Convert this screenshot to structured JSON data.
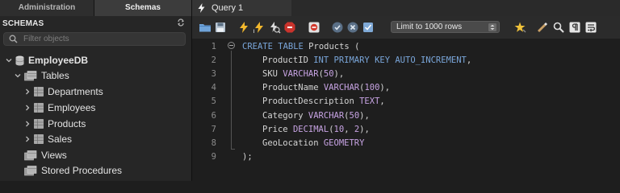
{
  "left_tabs": {
    "administration": "Administration",
    "schemas": "Schemas"
  },
  "schemas_panel": {
    "title": "SCHEMAS",
    "filter_placeholder": "Filter objects",
    "database": "EmployeeDB",
    "tables_folder": "Tables",
    "tables": [
      "Departments",
      "Employees",
      "Products",
      "Sales"
    ],
    "views_folder": "Views",
    "procedures_folder": "Stored Procedures"
  },
  "query_tab": {
    "label": "Query 1"
  },
  "toolbar": {
    "limit_label": "Limit to 1000 rows"
  },
  "editor": {
    "line_numbers": [
      "1",
      "2",
      "3",
      "4",
      "5",
      "6",
      "7",
      "8",
      "9"
    ],
    "lines": [
      [
        {
          "t": "CREATE TABLE",
          "c": "kw"
        },
        {
          "t": " Products (",
          "c": ""
        }
      ],
      [
        {
          "t": "ProductID ",
          "c": ""
        },
        {
          "t": "INT PRIMARY KEY AUTO_INCREMENT",
          "c": "kw"
        },
        {
          "t": ",",
          "c": ""
        }
      ],
      [
        {
          "t": "SKU ",
          "c": ""
        },
        {
          "t": "VARCHAR",
          "c": "ty"
        },
        {
          "t": "(",
          "c": ""
        },
        {
          "t": "50",
          "c": "nm"
        },
        {
          "t": "),",
          "c": ""
        }
      ],
      [
        {
          "t": "ProductName ",
          "c": ""
        },
        {
          "t": "VARCHAR",
          "c": "ty"
        },
        {
          "t": "(",
          "c": ""
        },
        {
          "t": "100",
          "c": "nm"
        },
        {
          "t": "),",
          "c": ""
        }
      ],
      [
        {
          "t": "ProductDescription ",
          "c": ""
        },
        {
          "t": "TEXT",
          "c": "ty"
        },
        {
          "t": ",",
          "c": ""
        }
      ],
      [
        {
          "t": "Category ",
          "c": ""
        },
        {
          "t": "VARCHAR",
          "c": "ty"
        },
        {
          "t": "(",
          "c": ""
        },
        {
          "t": "50",
          "c": "nm"
        },
        {
          "t": "),",
          "c": ""
        }
      ],
      [
        {
          "t": "Price ",
          "c": ""
        },
        {
          "t": "DECIMAL",
          "c": "ty"
        },
        {
          "t": "(",
          "c": ""
        },
        {
          "t": "10",
          "c": "nm"
        },
        {
          "t": ", ",
          "c": ""
        },
        {
          "t": "2",
          "c": "nm"
        },
        {
          "t": "),",
          "c": ""
        }
      ],
      [
        {
          "t": "GeoLocation ",
          "c": ""
        },
        {
          "t": "GEOMETRY",
          "c": "ty"
        }
      ],
      [
        {
          "t": ");",
          "c": ""
        }
      ]
    ]
  }
}
